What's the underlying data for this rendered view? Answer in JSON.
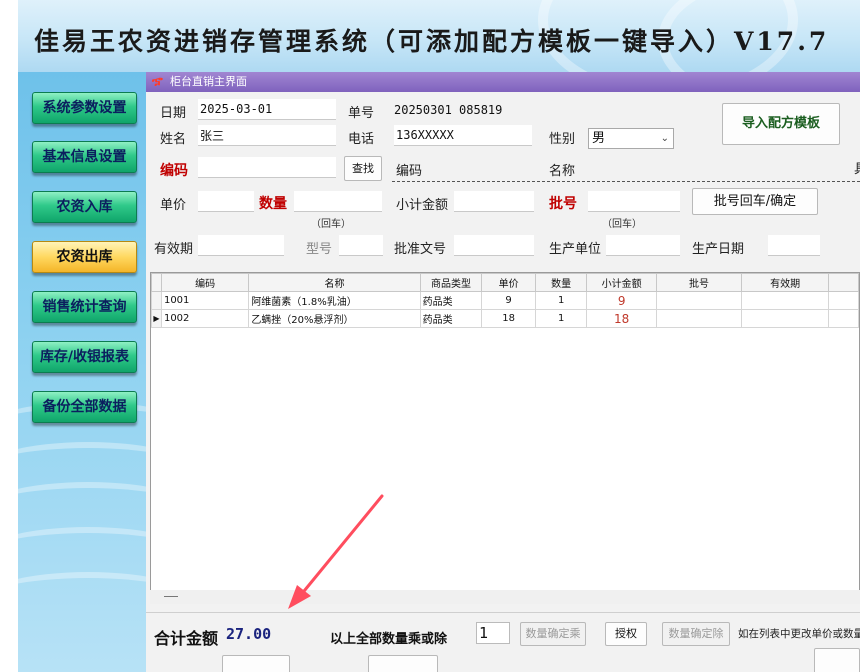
{
  "window": {
    "title": "佳易王农资进销存管理系统（可添加配方模板一键导入）V17.7",
    "panel_title": "柜台直销主界面",
    "panel_logo": "ኇ"
  },
  "sidebar": {
    "items": [
      {
        "label": "系统参数设置",
        "active": false
      },
      {
        "label": "基本信息设置",
        "active": false
      },
      {
        "label": "农资入库",
        "active": false
      },
      {
        "label": "农资出库",
        "active": true
      },
      {
        "label": "销售统计查询",
        "active": false
      },
      {
        "label": "库存/收银报表",
        "active": false
      },
      {
        "label": "备份全部数据",
        "active": false
      }
    ]
  },
  "form": {
    "date_label": "日期",
    "date_value": "2025-03-01",
    "order_label": "单号",
    "order_value": "20250301 085819",
    "name_label": "姓名",
    "name_value": "张三",
    "phone_label": "电话",
    "phone_value": "136XXXXX",
    "gender_label": "性别",
    "gender_value": "男",
    "import_button": "导入配方模板",
    "code_label": "编码",
    "code_value": "",
    "search_button": "查找",
    "code_display_label": "编码",
    "name_display_label": "名称",
    "cut_char": "具",
    "price_label": "单价",
    "qty_label": "数量",
    "qty_hint": "（回车）",
    "subtotal_label": "小计金额",
    "batch_label": "批号",
    "batch_hint": "（回车）",
    "batch_confirm_button": "批号回车/确定",
    "expiry_label": "有效期",
    "model_label": "型号",
    "approval_label": "批准文号",
    "producer_label": "生产单位",
    "prod_date_label": "生产日期"
  },
  "grid": {
    "columns": [
      "编码",
      "名称",
      "商品类型",
      "单价",
      "数量",
      "小计金额",
      "批号",
      "有效期"
    ],
    "rows": [
      {
        "code": "1001",
        "name": "阿维菌素（1.8%乳油）",
        "type": "药品类",
        "price": "9",
        "qty": "1",
        "subtotal": "9",
        "batch": "",
        "expiry": "",
        "current": false
      },
      {
        "code": "1002",
        "name": "乙螨挫（20%悬浮剂）",
        "type": "药品类",
        "price": "18",
        "qty": "1",
        "subtotal": "18",
        "batch": "",
        "expiry": "",
        "current": true
      }
    ],
    "current_row_marker": "▶"
  },
  "footer": {
    "total_label": "合计金额",
    "total_value": "27.00",
    "multiply_label": "以上全部数量乘或除",
    "multiply_value": "1",
    "confirm_multiply_button": "数量确定乘",
    "authorize_button": "授权",
    "confirm_divide_button": "数量确定除",
    "hint_text": "如在列表中更改单价或数量"
  },
  "colors": {
    "accent_purple": "#7f62bd",
    "sidebar_green": "#2fc98a",
    "active_yellow": "#ffd860",
    "annotation_arrow": "#ff4d5e"
  }
}
